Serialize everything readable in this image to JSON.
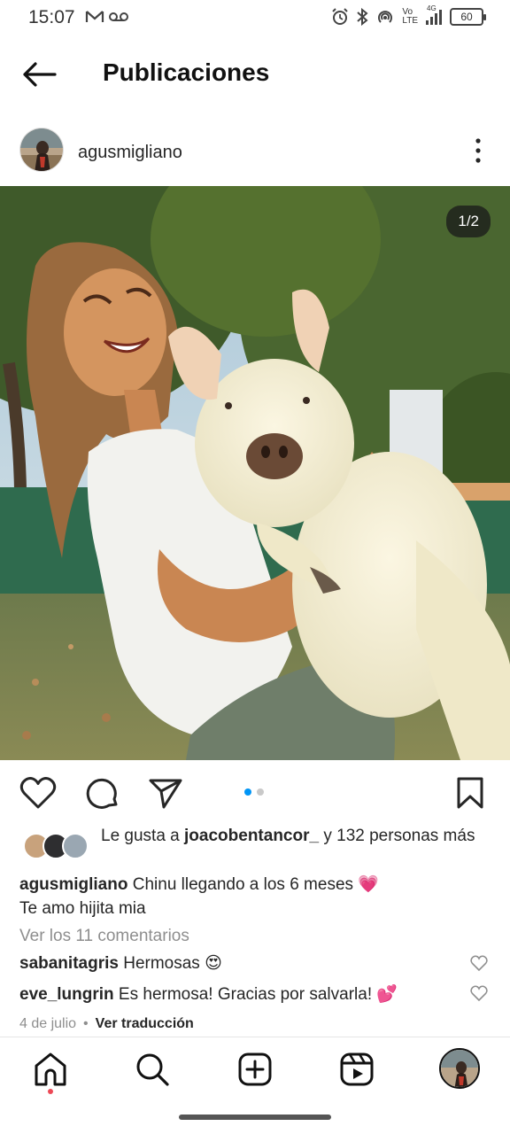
{
  "status_bar": {
    "time": "15:07",
    "network_vo": "Vo",
    "network_lte": "LTE",
    "network_4g": "4G",
    "battery": "60"
  },
  "header": {
    "title": "Publicaciones"
  },
  "post": {
    "username": "agusmigliano",
    "image_counter": "1/2",
    "carousel_position": 1,
    "carousel_total": 2,
    "likes": {
      "prefix": "Le gusta a ",
      "user": "joacobentancor_",
      "suffix": " y 132 personas más"
    },
    "caption": {
      "user": "agusmigliano",
      "text": " Chinu llegando a los 6 meses 💗",
      "line2": "Te amo hijita mia"
    },
    "view_comments": "Ver los 11 comentarios",
    "comments": [
      {
        "user": "sabanitagris",
        "text": " Hermosas 😍"
      },
      {
        "user": "eve_lungrin",
        "text": " Es hermosa! Gracias por salvarla! 💕"
      }
    ],
    "date": "4 de julio",
    "separator": "•",
    "translate_label": "Ver traducción"
  },
  "icons": {
    "back": "arrow-left-icon",
    "more": "more-vertical-icon",
    "like": "heart-icon",
    "comment": "comment-icon",
    "share": "send-icon",
    "save": "bookmark-icon",
    "home": "home-icon",
    "search": "search-icon",
    "create": "plus-square-icon",
    "reels": "reels-icon"
  },
  "colors": {
    "accent": "#0095f6",
    "notification": "#ed4956",
    "secondary_text": "#8e8e8e"
  }
}
